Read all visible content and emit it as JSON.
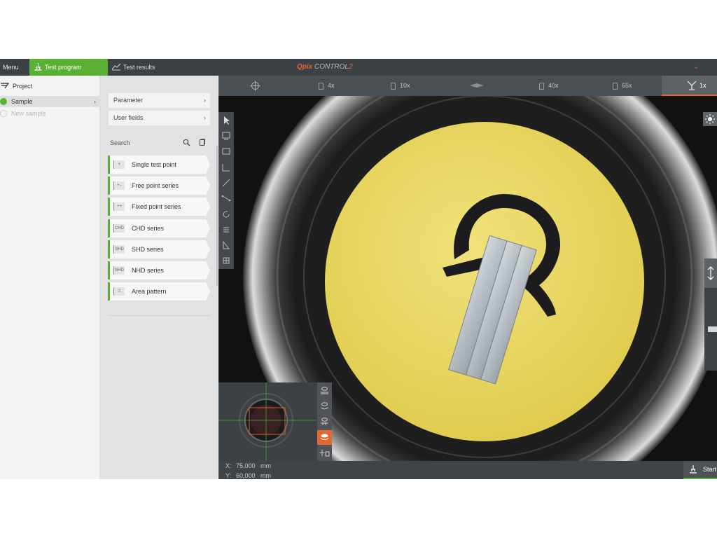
{
  "topbar": {
    "menu_label": "Menu",
    "tabs": [
      {
        "label": "Test program",
        "active": true
      },
      {
        "label": "Test results",
        "active": false
      }
    ],
    "logo": {
      "prefix": "Q",
      "pix": "pix",
      "control": "CONTROL",
      "suffix": "2"
    }
  },
  "project_panel": {
    "project_label": "Project",
    "sample_label": "Sample",
    "new_sample_label": "New sample"
  },
  "middle_panel": {
    "parameter_label": "Parameter",
    "user_fields_label": "User fields",
    "search_label": "Search",
    "items": [
      {
        "label": "Single test point",
        "icon": "single-point-icon",
        "glyph": "+"
      },
      {
        "label": "Free point series",
        "icon": "free-series-icon",
        "glyph": "+₊"
      },
      {
        "label": "Fixed point series",
        "icon": "fixed-series-icon",
        "glyph": "++"
      },
      {
        "label": "CHD series",
        "icon": "chd-icon",
        "glyph": "CHD"
      },
      {
        "label": "SHD series",
        "icon": "shd-icon",
        "glyph": "SHD"
      },
      {
        "label": "NHD series",
        "icon": "nhd-icon",
        "glyph": "NHD"
      },
      {
        "label": "Area pattern",
        "icon": "area-pattern-icon",
        "glyph": "⁞⁞⁞"
      }
    ]
  },
  "camera_toolbar": {
    "zooms": [
      "4x",
      "10x",
      "40x",
      "65x",
      "1x"
    ],
    "active_zoom": "1x"
  },
  "coordinates": {
    "x_label": "X:",
    "x_value": "75,000",
    "y_label": "Y:",
    "y_value": "60,000",
    "unit": "mm"
  },
  "start_label": "Start",
  "colors": {
    "accent_green": "#5ab032",
    "accent_orange": "#e06a30",
    "sample_yellow": "#e8d75e"
  }
}
